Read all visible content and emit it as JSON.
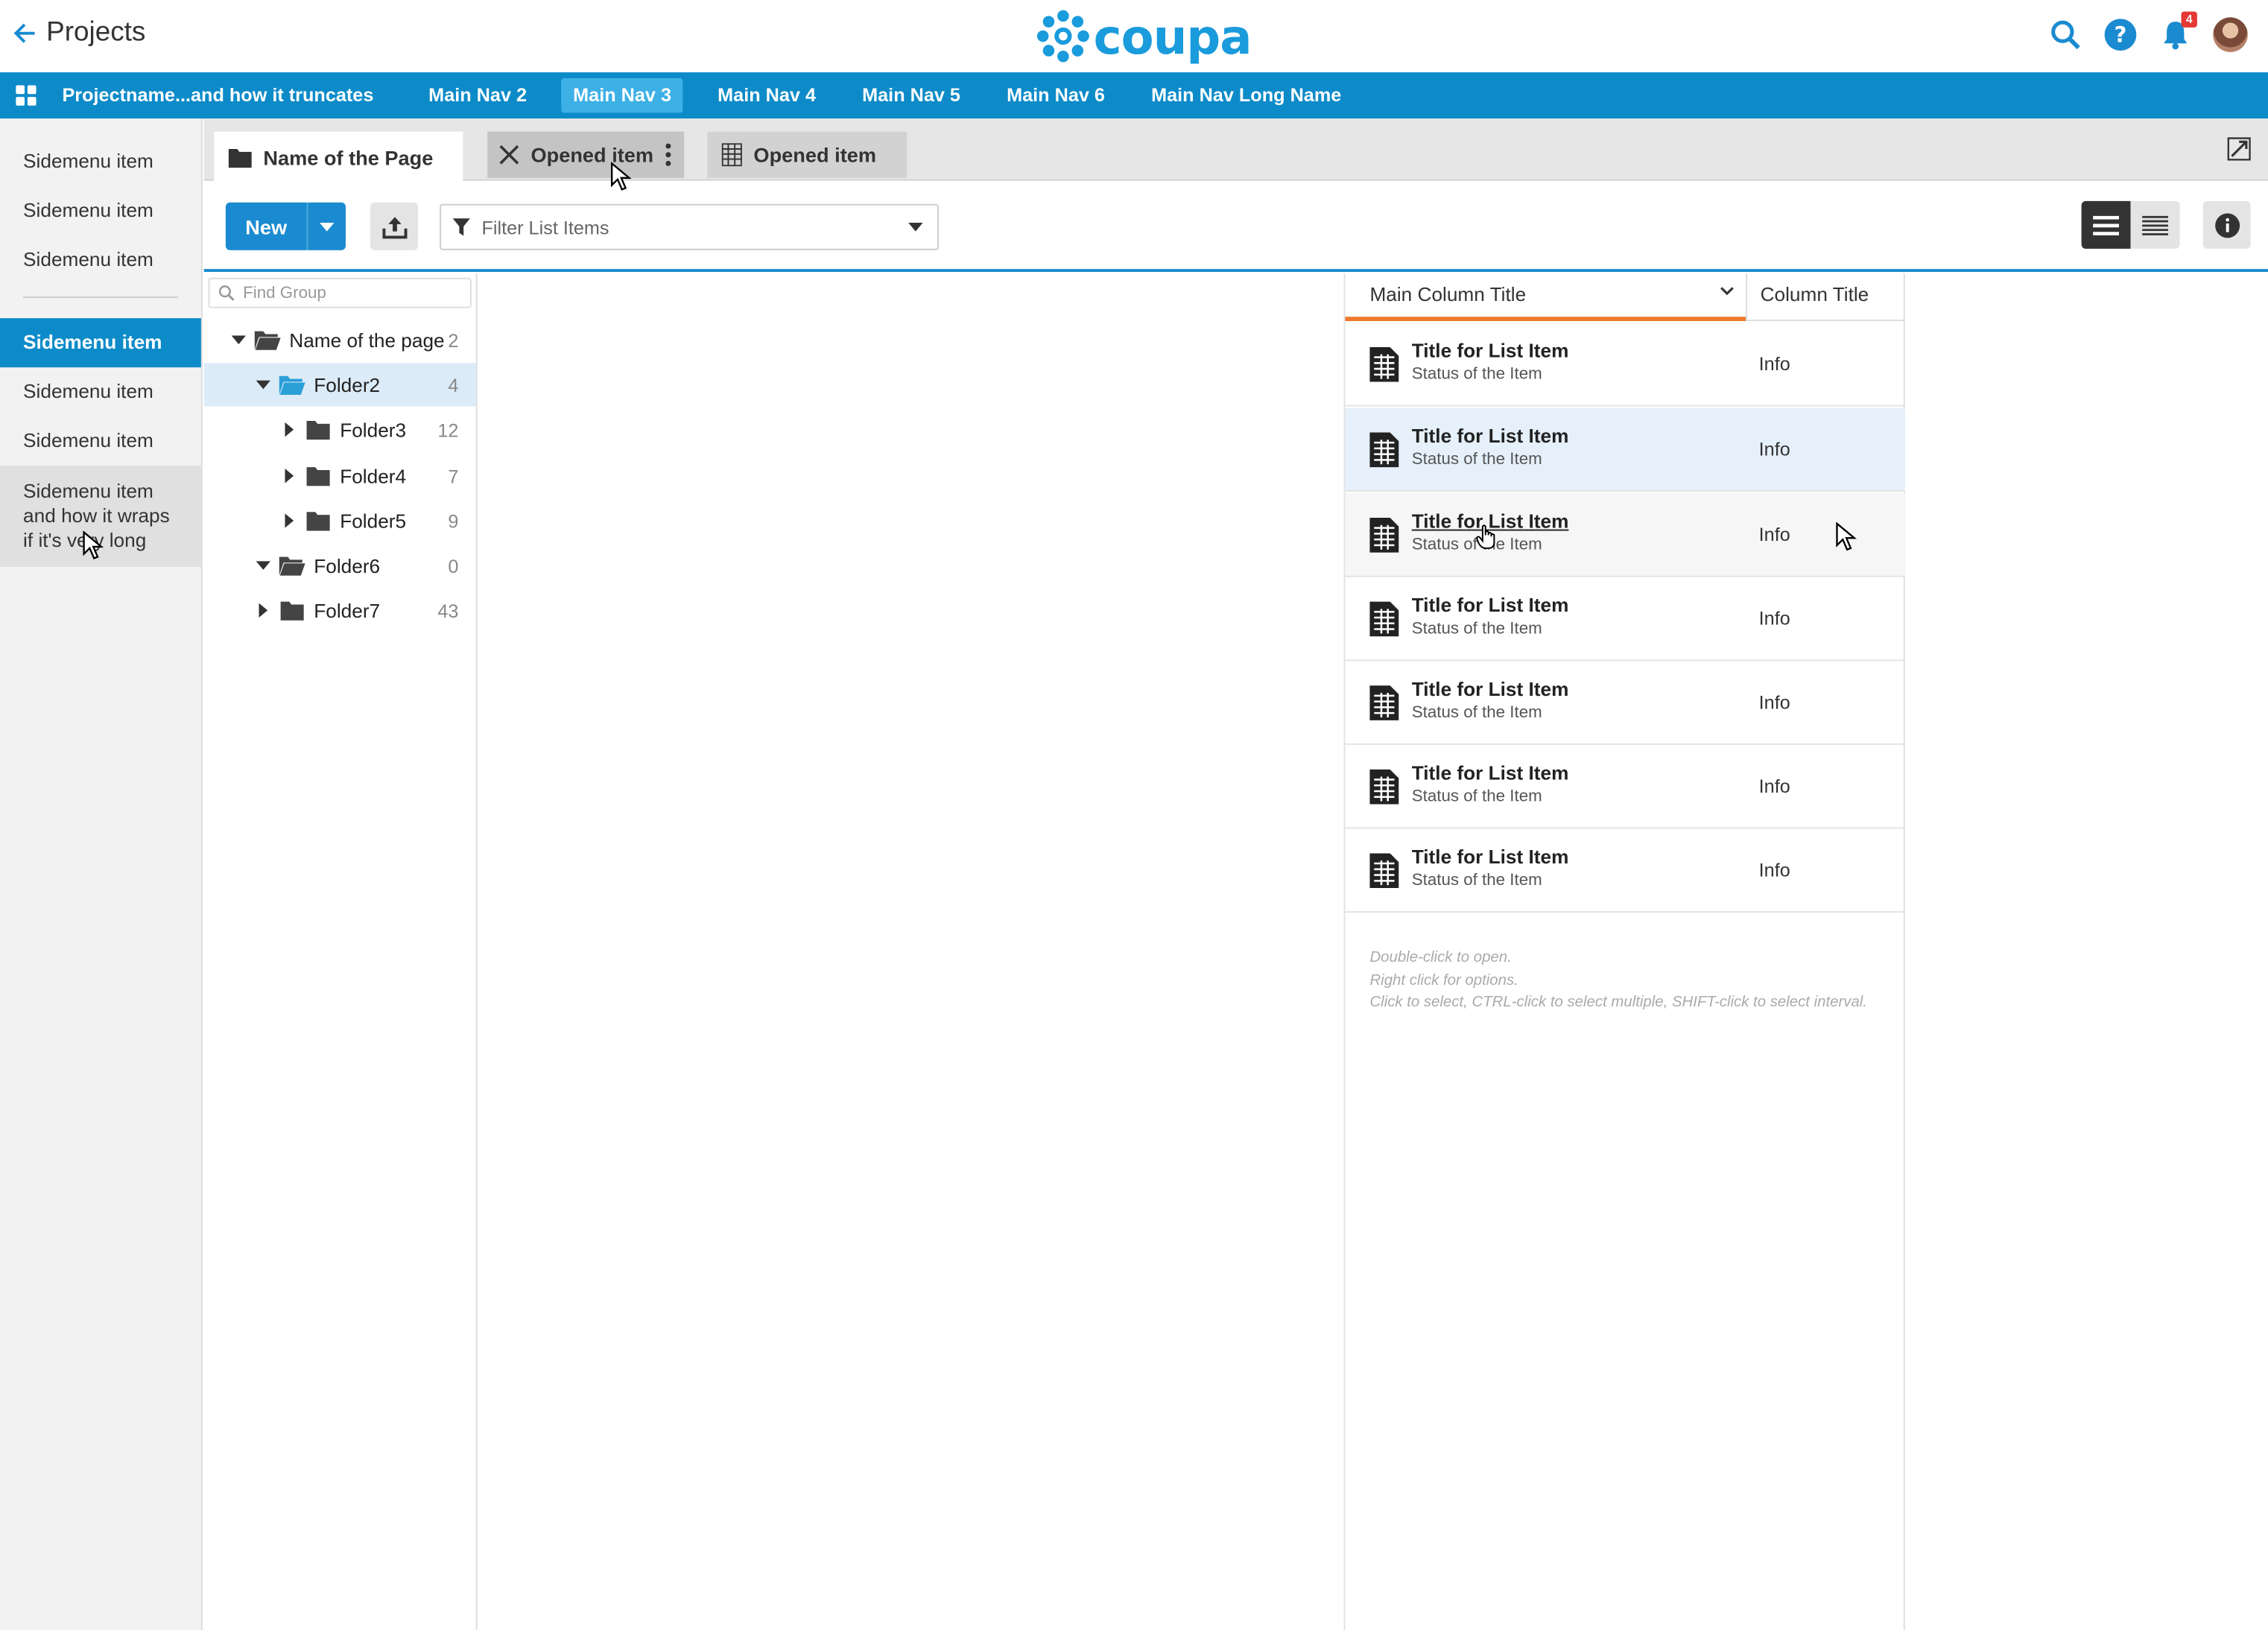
{
  "header": {
    "back_label": "Projects",
    "logo_text": "coupa",
    "notification_count": "4",
    "brand_color": "#1a9bdc"
  },
  "main_nav": {
    "items": [
      {
        "label": "Projectname...and how it truncates"
      },
      {
        "label": "Main Nav 2"
      },
      {
        "label": "Main Nav 3",
        "active": true
      },
      {
        "label": "Main Nav 4"
      },
      {
        "label": "Main Nav 5"
      },
      {
        "label": "Main Nav 6"
      },
      {
        "label": "Main Nav Long Name"
      }
    ],
    "color": "#0d8bc9"
  },
  "sidemenu": {
    "items": [
      {
        "label": "Sidemenu item"
      },
      {
        "label": "Sidemenu item"
      },
      {
        "label": "Sidemenu item"
      },
      {
        "label": "Sidemenu item",
        "active": true
      },
      {
        "label": "Sidemenu item"
      },
      {
        "label": "Sidemenu item"
      },
      {
        "label": "Sidemenu item and how it wraps if it's very long",
        "hover": true
      }
    ]
  },
  "tabs": [
    {
      "label": "Name of the Page",
      "icon": "folder-icon"
    },
    {
      "label": "Opened item",
      "icon": "close-icon"
    },
    {
      "label": "Opened item",
      "icon": "spreadsheet-icon"
    }
  ],
  "toolbar": {
    "new_label": "New",
    "filter_placeholder": "Filter List Items"
  },
  "tree": {
    "search_placeholder": "Find Group",
    "nodes": [
      {
        "label": "Name of the page",
        "count": "2",
        "expanded": true
      },
      {
        "label": "Folder2",
        "count": "4",
        "expanded": true,
        "selected": true
      },
      {
        "label": "Folder3",
        "count": "12"
      },
      {
        "label": "Folder4",
        "count": "7"
      },
      {
        "label": "Folder5",
        "count": "9"
      },
      {
        "label": "Folder6",
        "count": "0",
        "expanded": true
      },
      {
        "label": "Folder7",
        "count": "43"
      }
    ]
  },
  "list": {
    "main_column_title": "Main Column Title",
    "column_title": "Column Title",
    "rows": [
      {
        "title": "Title for List Item",
        "status": "Status of the Item",
        "info": "Info"
      },
      {
        "title": "Title for List Item",
        "status": "Status of the Item",
        "info": "Info",
        "selected": true
      },
      {
        "title": "Title for List Item",
        "status": "Status of the Item",
        "info": "Info",
        "hover": true
      },
      {
        "title": "Title for List Item",
        "status": "Status of the Item",
        "info": "Info"
      },
      {
        "title": "Title for List Item",
        "status": "Status of the Item",
        "info": "Info"
      },
      {
        "title": "Title for List Item",
        "status": "Status of the Item",
        "info": "Info"
      },
      {
        "title": "Title for List Item",
        "status": "Status of the Item",
        "info": "Info"
      }
    ],
    "hints": [
      "Double-click to open.",
      "Right click for options.",
      "Click to select, CTRL-click to select multiple, SHIFT-click to select interval."
    ],
    "sort_accent_color": "#ee7a2c"
  }
}
